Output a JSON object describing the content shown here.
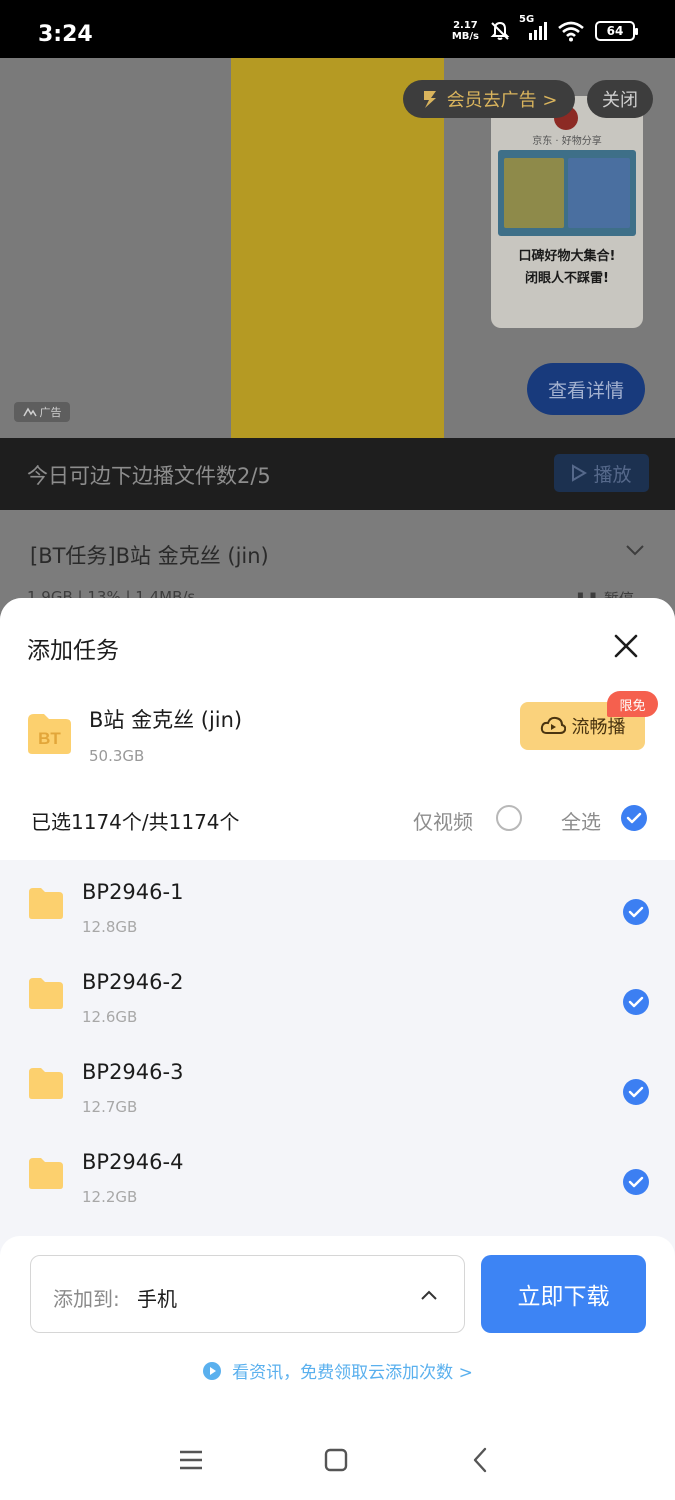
{
  "status_bar": {
    "time": "3:24",
    "net_speed_value": "2.17",
    "net_speed_unit": "MB/s",
    "network": "5G",
    "battery": "64"
  },
  "ad": {
    "vip_label": "会员去广告 >",
    "close_label": "关闭",
    "card_subtitle": "京东 · 好物分享",
    "card_text_line1": "口碑好物大集合!",
    "card_text_line2": "闭眼人不踩雷!",
    "ad_tag": "广告",
    "details_label": "查看详情"
  },
  "play_strip": {
    "text": "今日可边下边播文件数2/5",
    "play_label": "播放"
  },
  "task": {
    "title": "[BT任务]B站 金克丝 (jin)",
    "meta": "1.9GB | 13% | 1.4MB/s",
    "pause_label": "暂停"
  },
  "sheet": {
    "title": "添加任务",
    "torrent": {
      "icon_label": "BT",
      "name": "B站 金克丝 (jin)",
      "size": "50.3GB"
    },
    "stream_label": "流畅播",
    "limited_badge": "限免",
    "selected_count": "已选1174个/共1174个",
    "video_only_label": "仅视频",
    "video_only_checked": false,
    "select_all_label": "全选",
    "select_all_checked": true,
    "files": [
      {
        "name": "BP2946-1",
        "size": "12.8GB",
        "checked": true
      },
      {
        "name": "BP2946-2",
        "size": "12.6GB",
        "checked": true
      },
      {
        "name": "BP2946-3",
        "size": "12.7GB",
        "checked": true
      },
      {
        "name": "BP2946-4",
        "size": "12.2GB",
        "checked": true
      }
    ]
  },
  "footer": {
    "dest_prefix": "添加到:",
    "dest_value": "手机",
    "download_label": "立即下载",
    "promo_text": "看资讯，免费领取云添加次数 >"
  },
  "colors": {
    "accent": "#3d84f4",
    "check": "#3c7ff2",
    "stream_button": "#fad27c",
    "limited_badge": "#f5604e",
    "promo_link": "#5ab0ee"
  },
  "icons": {
    "close": "close-icon",
    "folder": "folder-icon",
    "check": "check-icon",
    "cloud_play": "cloud-play-icon",
    "play": "play-icon",
    "chevron": "chevron-up-icon"
  }
}
